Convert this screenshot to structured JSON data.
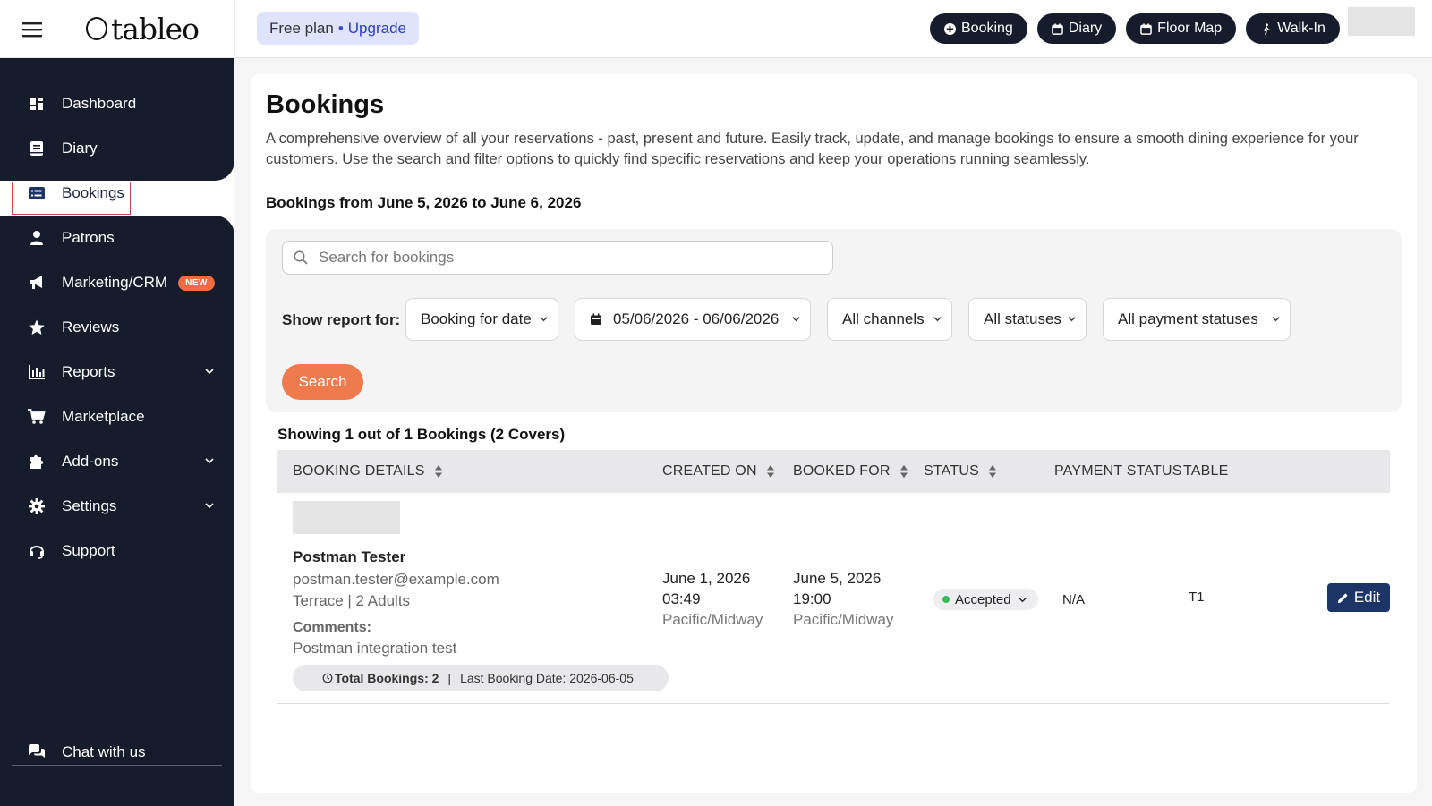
{
  "topbar": {
    "logo_text": "tableo",
    "plan_label": "Free plan",
    "plan_separator": "•",
    "upgrade_label": "Upgrade",
    "actions": [
      {
        "label": "Booking",
        "icon": "plus-circle-icon"
      },
      {
        "label": "Diary",
        "icon": "calendar-icon"
      },
      {
        "label": "Floor Map",
        "icon": "calendar-icon"
      },
      {
        "label": "Walk-In",
        "icon": "walking-icon"
      }
    ]
  },
  "sidebar": {
    "items": [
      {
        "label": "Dashboard",
        "icon": "dashboard-icon"
      },
      {
        "label": "Diary",
        "icon": "book-icon"
      },
      {
        "label": "Bookings",
        "icon": "list-icon",
        "active": true
      },
      {
        "label": "Patrons",
        "icon": "user-icon"
      },
      {
        "label": "Marketing/CRM",
        "icon": "megaphone-icon",
        "badge": "NEW"
      },
      {
        "label": "Reviews",
        "icon": "star-icon"
      },
      {
        "label": "Reports",
        "icon": "bar-chart-icon",
        "expandable": true
      },
      {
        "label": "Marketplace",
        "icon": "cart-icon"
      },
      {
        "label": "Add-ons",
        "icon": "puzzle-icon",
        "expandable": true
      },
      {
        "label": "Settings",
        "icon": "gear-icon",
        "expandable": true
      },
      {
        "label": "Support",
        "icon": "headset-icon"
      }
    ],
    "chat_label": "Chat with us"
  },
  "main": {
    "title": "Bookings",
    "description": "A comprehensive overview of all your reservations - past, present and future. Easily track, update, and manage bookings to ensure a smooth dining experience for your customers. Use the search and filter options to quickly find specific reservations and keep your operations running seamlessly.",
    "range_text": "Bookings from June 5, 2026 to June 6, 2026",
    "filters": {
      "search_placeholder": "Search for bookings",
      "show_report_label": "Show report for:",
      "booking_type": "Booking for date",
      "date_range": "05/06/2026 - 06/06/2026",
      "channels": "All channels",
      "statuses": "All statuses",
      "payment_statuses": "All payment statuses",
      "search_button": "Search"
    },
    "showing_text": "Showing 1 out of 1 Bookings (2 Covers)",
    "table": {
      "headers": {
        "details": "BOOKING DETAILS",
        "created": "CREATED ON",
        "booked": "BOOKED FOR",
        "status": "STATUS",
        "payment": "PAYMENT STATUS",
        "table": "TABLE"
      },
      "rows": [
        {
          "name": "Postman Tester",
          "email": "postman.tester@example.com",
          "area": "Terrace | 2 Adults",
          "comments_label": "Comments:",
          "comments": "Postman integration test",
          "history_total": "Total Bookings: 2",
          "history_sep": "|",
          "history_last": "Last Booking Date: 2026-06-05",
          "created_date": "June 1, 2026",
          "created_time": "03:49",
          "created_tz": "Pacific/Midway",
          "booked_date": "June 5, 2026",
          "booked_time": "19:00",
          "booked_tz": "Pacific/Midway",
          "status": "Accepted",
          "status_color": "#3ab85a",
          "payment_status": "N/A",
          "table": "T1",
          "edit_label": "Edit"
        }
      ]
    }
  }
}
